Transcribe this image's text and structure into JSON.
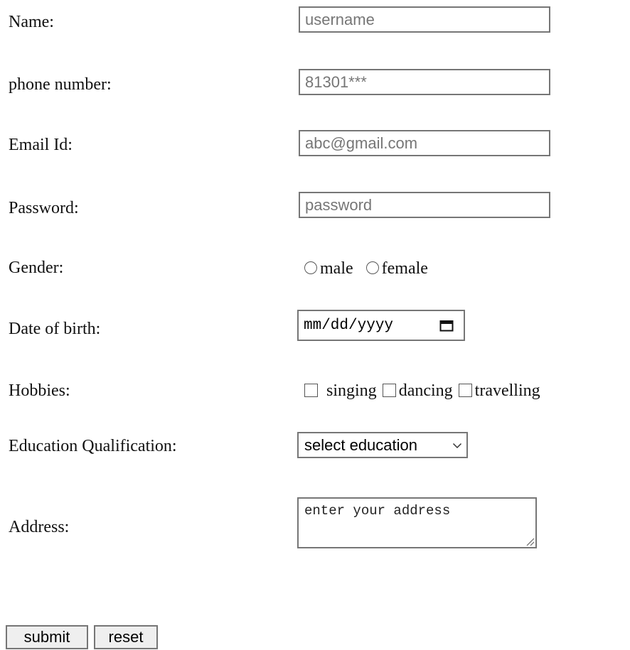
{
  "form": {
    "name": {
      "label": "Name:",
      "placeholder": "username",
      "value": ""
    },
    "phone": {
      "label": "phone number:",
      "placeholder": "81301***",
      "value": ""
    },
    "email": {
      "label": "Email Id:",
      "placeholder": "abc@gmail.com",
      "value": ""
    },
    "password": {
      "label": "Password:",
      "placeholder": "password",
      "value": ""
    },
    "gender": {
      "label": "Gender:",
      "options": [
        "male",
        "female"
      ],
      "selected": null
    },
    "dob": {
      "label": "Date of birth:",
      "placeholder": "mm/dd/yyyy",
      "icon": "calendar-icon"
    },
    "hobbies": {
      "label": "Hobbies:",
      "options": [
        "singing",
        "dancing",
        "travelling"
      ],
      "checked": []
    },
    "education": {
      "label": "Education Qualification:",
      "selected": "select education",
      "icon": "chevron-down-icon"
    },
    "address": {
      "label": "Address:",
      "placeholder": "enter your address"
    }
  },
  "buttons": {
    "submit": "submit",
    "reset": "reset"
  }
}
